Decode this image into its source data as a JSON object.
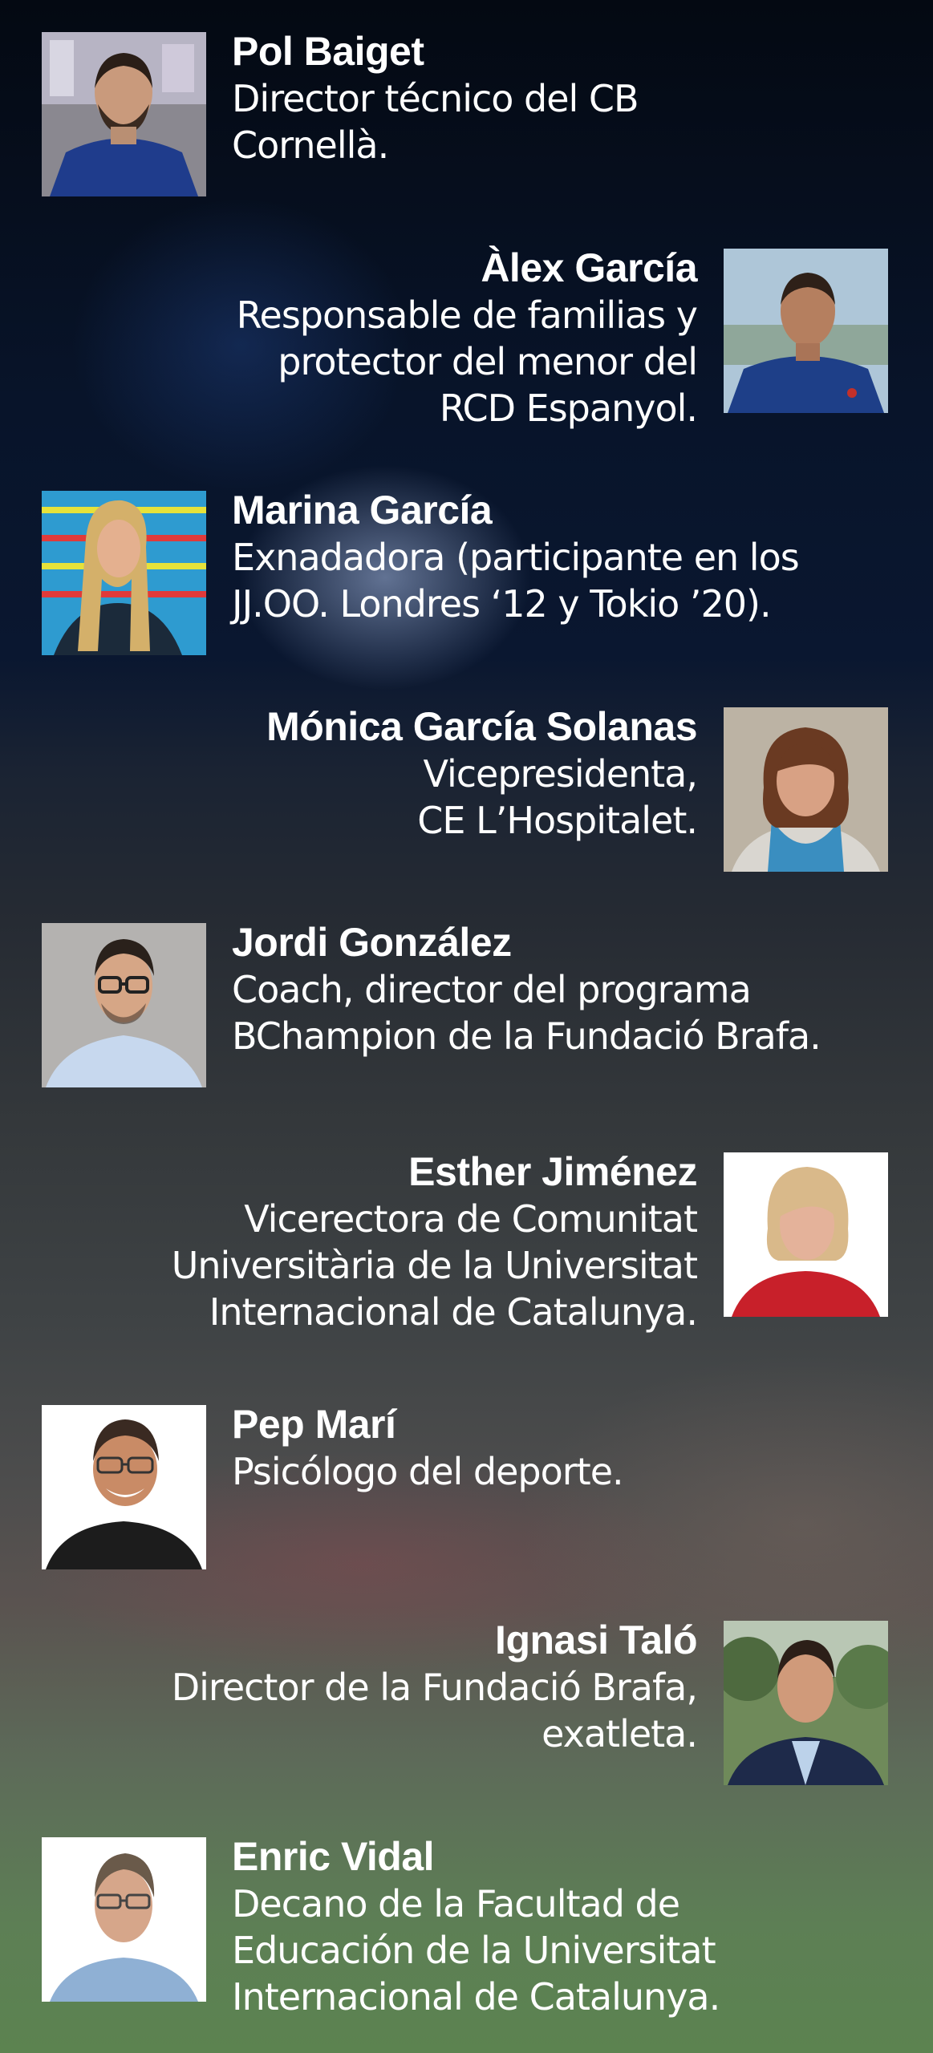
{
  "speakers": [
    {
      "name": "Pol Baiget",
      "role": "Director técnico del CB\nCornellà."
    },
    {
      "name": "Àlex García",
      "role": "Responsable de familias y\nprotector del menor del\nRCD Espanyol."
    },
    {
      "name": "Marina García",
      "role": "Exnadadora (participante en los\nJJ.OO. Londres ‘12 y Tokio ’20)."
    },
    {
      "name": "Mónica García Solanas",
      "role": "Vicepresidenta,\nCE L’Hospitalet."
    },
    {
      "name": "Jordi González",
      "role": "Coach, director del programa\nBChampion de la Fundació Brafa."
    },
    {
      "name": "Esther Jiménez",
      "role": "Vicerectora de Comunitat\nUniversitària de la Universitat\nInternacional de Catalunya."
    },
    {
      "name": "Pep Marí",
      "role": "Psicólogo del deporte."
    },
    {
      "name": "Ignasi Taló",
      "role": "Director de la Fundació Brafa,\nexatleta."
    },
    {
      "name": "Enric Vidal",
      "role": "Decano de la Facultad de\nEducación de la Universitat\nInternacional de Catalunya."
    }
  ]
}
